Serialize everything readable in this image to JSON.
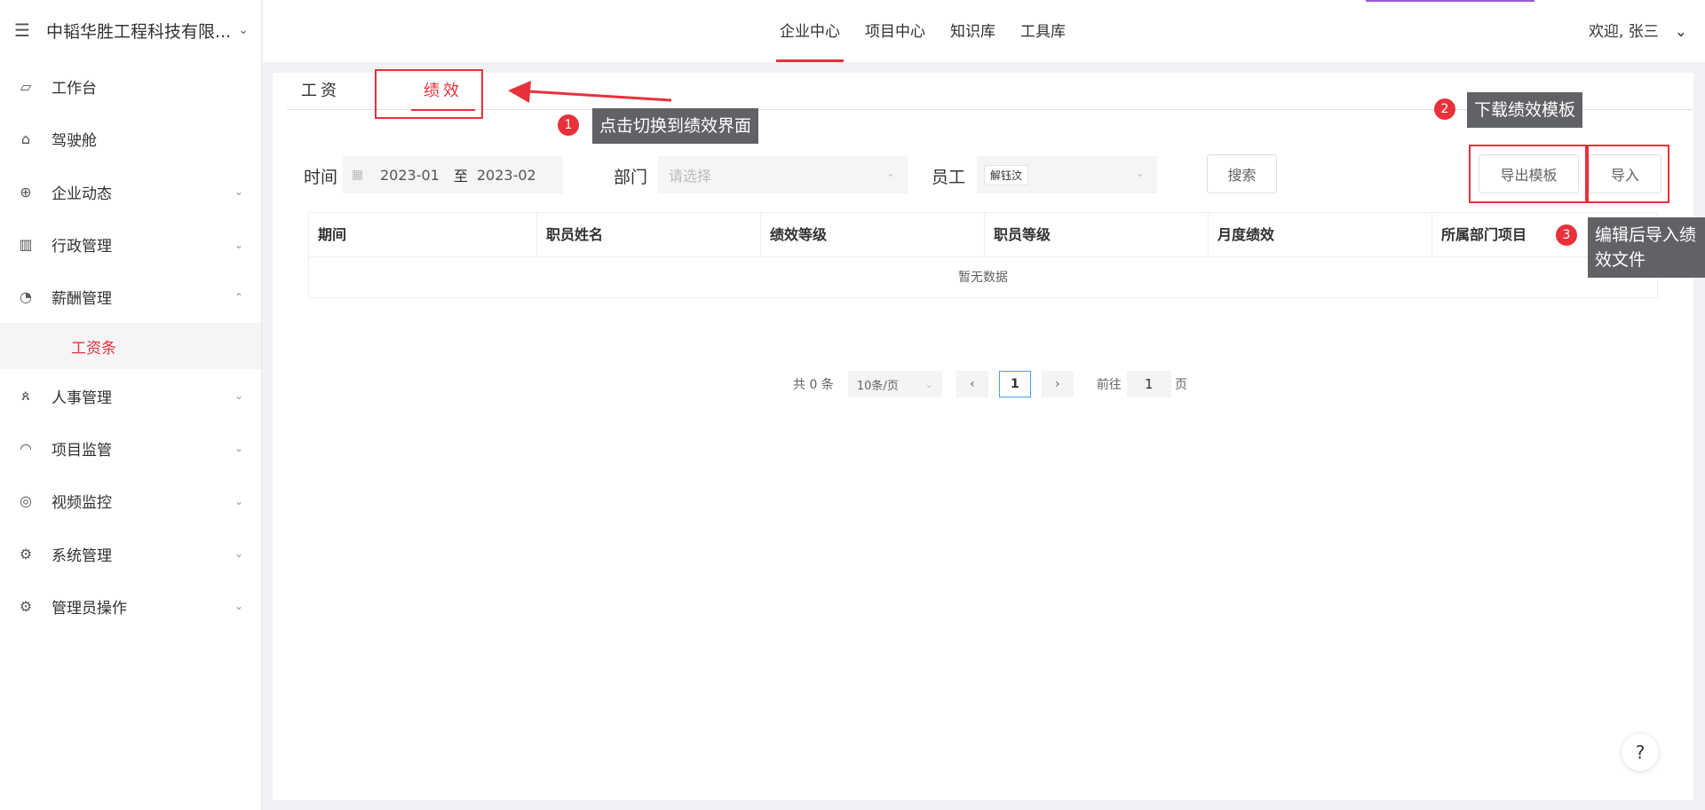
{
  "brand": {
    "name": "中韬华胜工程科技有限..."
  },
  "sidebar": {
    "items": [
      {
        "label": "工作台",
        "icon": "chart-line-icon",
        "chevron": ""
      },
      {
        "label": "驾驶舱",
        "icon": "home-icon",
        "chevron": ""
      },
      {
        "label": "企业动态",
        "icon": "globe-icon",
        "chevron": "⌄"
      },
      {
        "label": "行政管理",
        "icon": "building-icon",
        "chevron": "⌄"
      },
      {
        "label": "薪酬管理",
        "icon": "salary-icon",
        "chevron": "⌃"
      },
      {
        "label": "人事管理",
        "icon": "people-icon",
        "chevron": "⌄"
      },
      {
        "label": "项目监管",
        "icon": "helmet-icon",
        "chevron": "⌄"
      },
      {
        "label": "视频监控",
        "icon": "camera-icon",
        "chevron": "⌄"
      },
      {
        "label": "系统管理",
        "icon": "settings-icon",
        "chevron": "⌄"
      },
      {
        "label": "管理员操作",
        "icon": "settings-icon",
        "chevron": "⌄"
      }
    ],
    "sub_item": "工资条"
  },
  "topnav": {
    "items": [
      "企业中心",
      "项目中心",
      "知识库",
      "工具库"
    ],
    "welcome": "欢迎, 张三"
  },
  "tabs": [
    "工资",
    "绩效"
  ],
  "filters": {
    "time_label": "时间",
    "date_start": "2023-01",
    "date_sep": "至",
    "date_end": "2023-02",
    "dept_label": "部门",
    "dept_placeholder": "请选择",
    "employee_label": "员工",
    "employee_tag": "解钰汶",
    "search_button": "搜索",
    "export_button": "导出模板",
    "import_button": "导入"
  },
  "table": {
    "columns": [
      "期间",
      "职员姓名",
      "绩效等级",
      "职员等级",
      "月度绩效",
      "所属部门项目"
    ],
    "empty_text": "暂无数据"
  },
  "pagination": {
    "total": "共 0 条",
    "page_size": "10条/页",
    "current": "1",
    "goto_label": "前往",
    "goto_value": "1",
    "page_suffix": "页"
  },
  "help": "?",
  "annotations": [
    {
      "number": "1",
      "text": "点击切换到绩效界面"
    },
    {
      "number": "2",
      "text": "下载绩效模板"
    },
    {
      "number": "3",
      "text": "编辑后导入绩效文件"
    }
  ],
  "colors": {
    "accent": "#e6323e",
    "annotation_red": "#e8313a",
    "callout_bg": "#606266"
  }
}
